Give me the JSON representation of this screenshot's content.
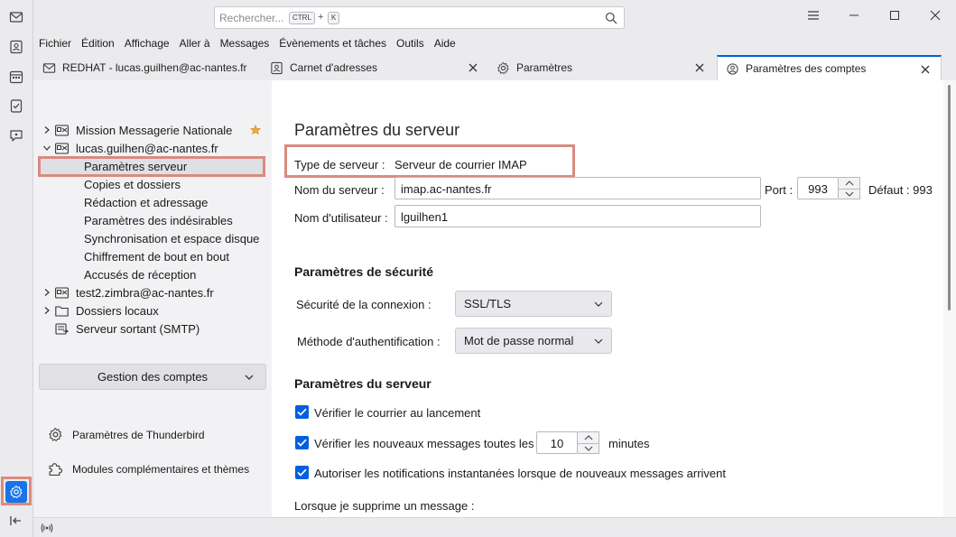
{
  "window": {
    "search_placeholder": "Rechercher...",
    "shortcut_ctrl": "CTRL",
    "shortcut_plus": "+",
    "shortcut_key": "K"
  },
  "menubar": [
    "Fichier",
    "Édition",
    "Affichage",
    "Aller à",
    "Messages",
    "Évènements et tâches",
    "Outils",
    "Aide"
  ],
  "tabs": [
    {
      "label": "REDHAT - lucas.guilhen@ac-nantes.fr",
      "icon": "mail-icon"
    },
    {
      "label": "Carnet d'adresses",
      "icon": "address-book-icon"
    },
    {
      "label": "Paramètres",
      "icon": "gear-icon"
    },
    {
      "label": "Paramètres des comptes",
      "icon": "account-settings-icon",
      "active": true
    }
  ],
  "sidebar": {
    "accounts": [
      {
        "label": "Mission Messagerie Nationale",
        "starred": true
      },
      {
        "label": "lucas.guilhen@ac-nantes.fr",
        "expanded": true
      }
    ],
    "subitems": [
      "Paramètres serveur",
      "Copies et dossiers",
      "Rédaction et adressage",
      "Paramètres des indésirables",
      "Synchronisation et espace disque",
      "Chiffrement de bout en bout",
      "Accusés de réception"
    ],
    "other_accounts": [
      "test2.zimbra@ac-nantes.fr",
      "Dossiers locaux",
      "Serveur sortant (SMTP)"
    ],
    "gestion_label": "Gestion des comptes",
    "links": [
      "Paramètres de Thunderbird",
      "Modules complémentaires et thèmes"
    ]
  },
  "main": {
    "title": "Paramètres du serveur",
    "server_type_label": "Type de serveur :",
    "server_type_value": "Serveur de courrier IMAP",
    "server_name_label": "Nom du serveur :",
    "server_name_value": "imap.ac-nantes.fr",
    "port_label": "Port :",
    "port_value": "993",
    "port_default": "Défaut : 993",
    "username_label": "Nom d'utilisateur :",
    "username_value": "lguilhen1",
    "security_heading": "Paramètres de sécurité",
    "connection_security_label": "Sécurité de la connexion :",
    "connection_security_value": "SSL/TLS",
    "auth_method_label": "Méthode d'authentification :",
    "auth_method_value": "Mot de passe normal",
    "server_heading": "Paramètres du serveur",
    "check_startup_label": "Vérifier le courrier au lancement",
    "check_every_label": "Vérifier les nouveaux messages toutes les",
    "check_every_value": "10",
    "minutes_label": "minutes",
    "push_notif_label": "Autoriser les notifications instantanées lorsque de nouveaux messages arrivent",
    "delete_label": "Lorsque je supprime un message :"
  },
  "colors": {
    "accent": "#0060df",
    "highlight": "#d98b7f",
    "gear_bg": "#1a73e8"
  }
}
